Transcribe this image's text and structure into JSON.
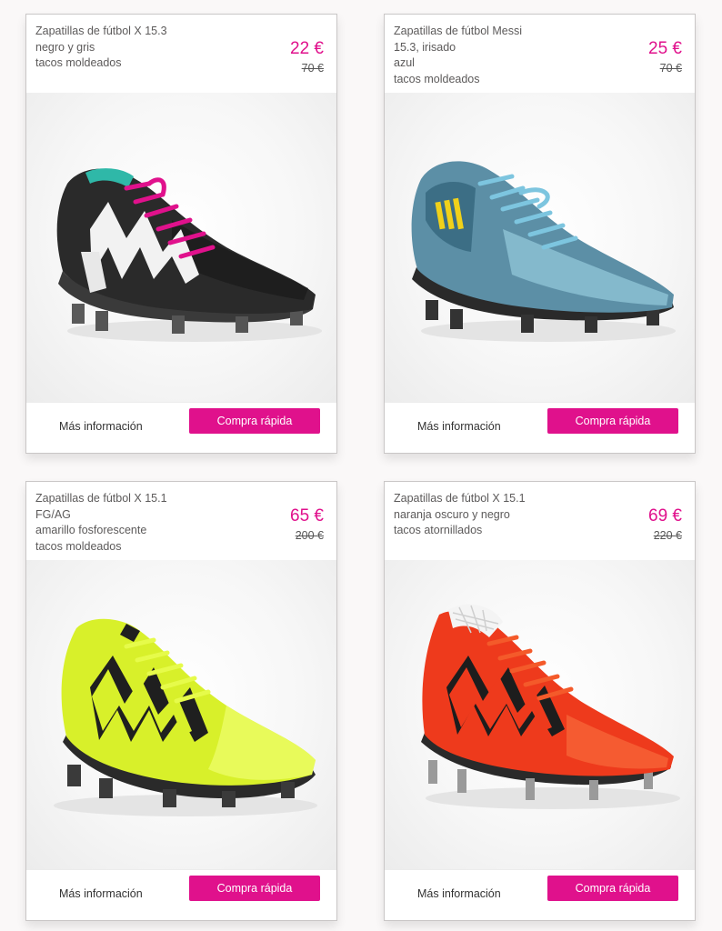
{
  "colors": {
    "accent": "#e0118c",
    "text": "#5c5a5a",
    "border": "#c9c6c6"
  },
  "products": [
    {
      "title_lines": [
        "Zapatillas de fútbol X 15.3",
        "negro y gris",
        "tacos moldeados"
      ],
      "price": "22 €",
      "old_price": "70 €",
      "image": "black-white-pink-boot",
      "more_label": "Más información",
      "buy_label": "Compra rápida"
    },
    {
      "title_lines": [
        "Zapatillas de fútbol Messi",
        "15.3, irisado",
        "azul",
        "tacos moldeados"
      ],
      "price": "25 €",
      "old_price": "70 €",
      "image": "iridescent-blue-boot",
      "more_label": "Más información",
      "buy_label": "Compra rápida"
    },
    {
      "title_lines": [
        "Zapatillas de fútbol X 15.1",
        "FG/AG",
        "amarillo fosforescente",
        "tacos moldeados"
      ],
      "price": "65 €",
      "old_price": "200 €",
      "image": "neon-yellow-boot",
      "more_label": "Más información",
      "buy_label": "Compra rápida"
    },
    {
      "title_lines": [
        "Zapatillas de fútbol X 15.1",
        "naranja oscuro y negro",
        "tacos atornillados"
      ],
      "price": "69 €",
      "old_price": "220 €",
      "image": "orange-black-boot",
      "more_label": "Más información",
      "buy_label": "Compra rápida"
    }
  ]
}
